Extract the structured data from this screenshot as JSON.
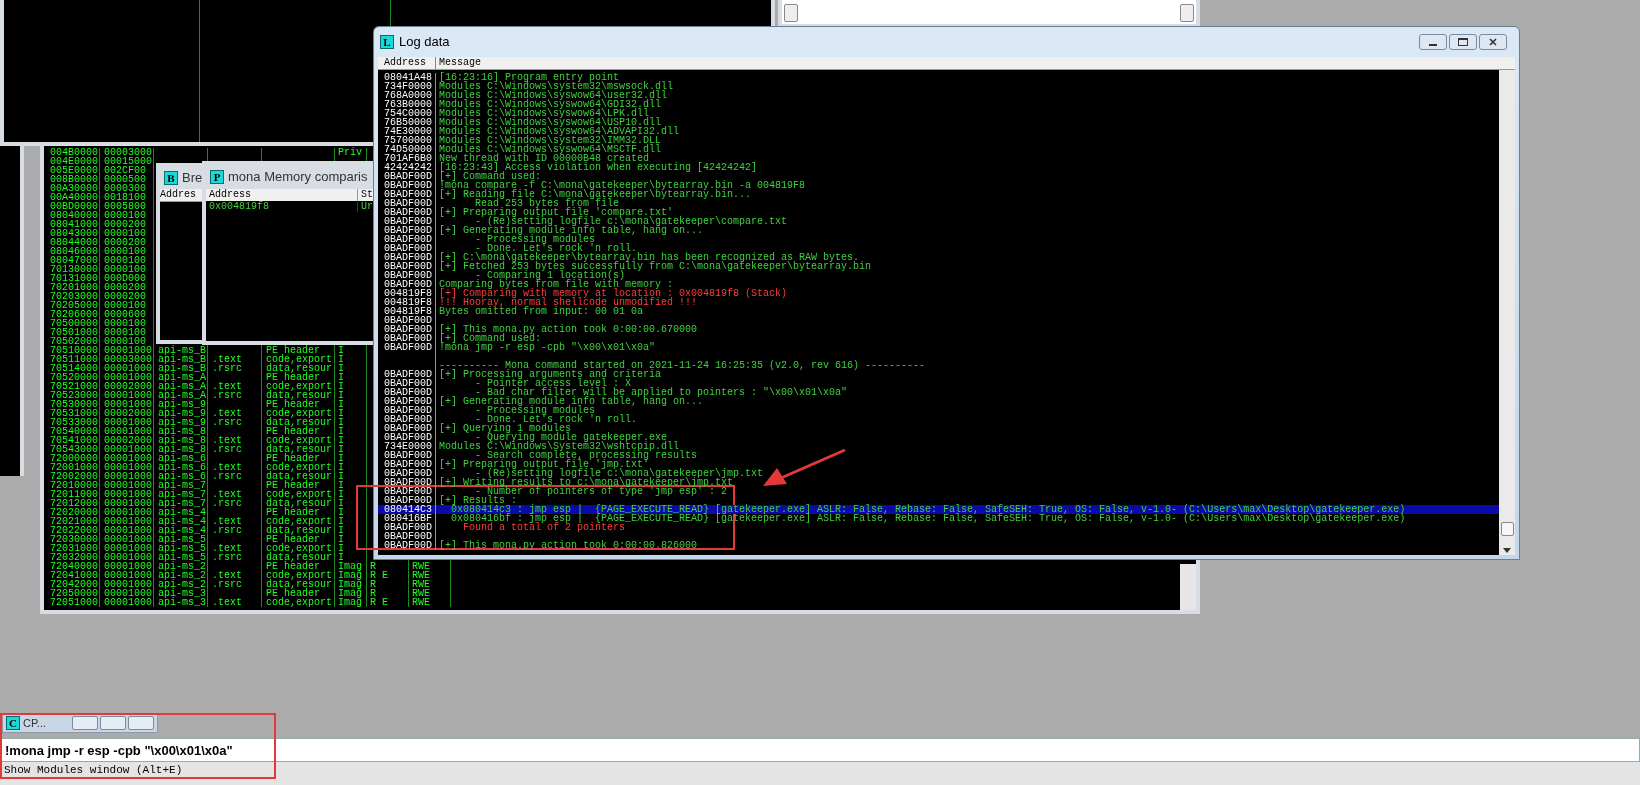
{
  "log_window": {
    "icon_letter": "L",
    "title": "Log data",
    "columns": [
      "Address",
      "Message"
    ],
    "rows": [
      {
        "address": "08041A48",
        "message": "[16:23:16] Program entry point",
        "kind": "info",
        "selected": false
      },
      {
        "address": "734F0000",
        "message": "Modules C:\\Windows\\system32\\mswsock.dll",
        "kind": "info",
        "selected": false
      },
      {
        "address": "768A0000",
        "message": "Modules C:\\Windows\\syswow64\\user32.dll",
        "kind": "info",
        "selected": false
      },
      {
        "address": "763B0000",
        "message": "Modules C:\\Windows\\syswow64\\GDI32.dll",
        "kind": "info",
        "selected": false
      },
      {
        "address": "754C0000",
        "message": "Modules C:\\Windows\\syswow64\\LPK.dll",
        "kind": "info",
        "selected": false
      },
      {
        "address": "76B50000",
        "message": "Modules C:\\Windows\\syswow64\\USP10.dll",
        "kind": "info",
        "selected": false
      },
      {
        "address": "74E30000",
        "message": "Modules C:\\Windows\\syswow64\\ADVAPI32.dll",
        "kind": "info",
        "selected": false
      },
      {
        "address": "75700000",
        "message": "Modules C:\\Windows\\system32\\IMM32.DLL",
        "kind": "info",
        "selected": false
      },
      {
        "address": "74D50000",
        "message": "Modules C:\\Windows\\syswow64\\MSCTF.dll",
        "kind": "info",
        "selected": false
      },
      {
        "address": "701AF6B0",
        "message": "New thread with ID 00000B48 created",
        "kind": "info",
        "selected": false
      },
      {
        "address": "42424242",
        "message": "[16:23:43] Access violation when executing [42424242]",
        "kind": "info",
        "selected": false
      },
      {
        "address": "0BADF00D",
        "message": "[+] Command used:",
        "kind": "info",
        "selected": false
      },
      {
        "address": "0BADF00D",
        "message": "!mona compare -f C:\\mona\\gatekeeper\\bytearray.bin -a 004819F8",
        "kind": "info",
        "selected": false
      },
      {
        "address": "0BADF00D",
        "message": "[+] Reading file C:\\mona\\gatekeeper\\bytearray.bin...",
        "kind": "info",
        "selected": false
      },
      {
        "address": "0BADF00D",
        "message": "      Read 253 bytes from file",
        "kind": "info",
        "selected": false
      },
      {
        "address": "0BADF00D",
        "message": "[+] Preparing output file 'compare.txt'",
        "kind": "info",
        "selected": false
      },
      {
        "address": "0BADF00D",
        "message": "      - (Re)setting logfile c:\\mona\\gatekeeper\\compare.txt",
        "kind": "info",
        "selected": false
      },
      {
        "address": "0BADF00D",
        "message": "[+] Generating module info table, hang on...",
        "kind": "info",
        "selected": false
      },
      {
        "address": "0BADF00D",
        "message": "      - Processing modules",
        "kind": "info",
        "selected": false
      },
      {
        "address": "0BADF00D",
        "message": "      - Done. Let's rock 'n roll.",
        "kind": "info",
        "selected": false
      },
      {
        "address": "0BADF00D",
        "message": "[+] C:\\mona\\gatekeeper\\bytearray.bin has been recognized as RAW bytes.",
        "kind": "info",
        "selected": false
      },
      {
        "address": "0BADF00D",
        "message": "[+] Fetched 253 bytes successfully from C:\\mona\\gatekeeper\\bytearray.bin",
        "kind": "info",
        "selected": false
      },
      {
        "address": "0BADF00D",
        "message": "      - Comparing 1 location(s)",
        "kind": "info",
        "selected": false
      },
      {
        "address": "0BADF00D",
        "message": "Comparing bytes from file with memory :",
        "kind": "info",
        "selected": false
      },
      {
        "address": "004819F8",
        "message": "[+] Comparing with memory at location : 0x004819f8 (Stack)",
        "kind": "alert",
        "selected": false
      },
      {
        "address": "004819F8",
        "message": "!!! Hooray, normal shellcode unmodified !!!",
        "kind": "alert",
        "selected": false
      },
      {
        "address": "004819F8",
        "message": "Bytes omitted from input: 00 01 0a",
        "kind": "info",
        "selected": false
      },
      {
        "address": "0BADF00D",
        "selected": false
      },
      {
        "address": "0BADF00D",
        "message": "[+] This mona.py action took 0:00:00.670000",
        "kind": "info",
        "selected": false
      },
      {
        "address": "0BADF00D",
        "message": "[+] Command used:",
        "kind": "info",
        "selected": false
      },
      {
        "address": "0BADF00D",
        "message": "!mona jmp -r esp -cpb \"\\x00\\x01\\x0a\"",
        "kind": "info",
        "selected": false
      },
      {
        "selected": false
      },
      {
        "message": "---------- Mona command started on 2021-11-24 16:25:35 (v2.0, rev 616) ----------",
        "kind": "info",
        "selected": false
      },
      {
        "address": "0BADF00D",
        "message": "[+] Processing arguments and criteria",
        "kind": "info",
        "selected": false
      },
      {
        "address": "0BADF00D",
        "message": "      - Pointer access level : X",
        "kind": "info",
        "selected": false
      },
      {
        "address": "0BADF00D",
        "message": "      - Bad char filter will be applied to pointers : \"\\x00\\x01\\x0a\"",
        "kind": "info",
        "selected": false
      },
      {
        "address": "0BADF00D",
        "message": "[+] Generating module info table, hang on...",
        "kind": "info",
        "selected": false
      },
      {
        "address": "0BADF00D",
        "message": "      - Processing modules",
        "kind": "info",
        "selected": false
      },
      {
        "address": "0BADF00D",
        "message": "      - Done. Let's rock 'n roll.",
        "kind": "info",
        "selected": false
      },
      {
        "address": "0BADF00D",
        "message": "[+] Querying 1 modules",
        "kind": "info",
        "selected": false
      },
      {
        "address": "0BADF00D",
        "message": "      - Querying module gatekeeper.exe",
        "kind": "info",
        "selected": false
      },
      {
        "address": "734E0000",
        "message": "Modules C:\\Windows\\System32\\wshtcpip.dll",
        "kind": "info",
        "selected": false
      },
      {
        "address": "0BADF00D",
        "message": "      - Search complete, processing results",
        "kind": "info",
        "selected": false
      },
      {
        "address": "0BADF00D",
        "message": "[+] Preparing output file 'jmp.txt'",
        "kind": "info",
        "selected": false
      },
      {
        "address": "0BADF00D",
        "message": "      - (Re)setting logfile c:\\mona\\gatekeeper\\jmp.txt",
        "kind": "info",
        "selected": false
      },
      {
        "address": "0BADF00D",
        "message": "[+] Writing results to c:\\mona\\gatekeeper\\jmp.txt",
        "kind": "info",
        "selected": false
      },
      {
        "address": "0BADF00D",
        "message": "      - Number of pointers of type 'jmp esp' : 2",
        "kind": "info",
        "selected": false
      },
      {
        "address": "0BADF00D",
        "message": "[+] Results :",
        "kind": "info",
        "selected": false
      },
      {
        "address": "080414C3",
        "message": "  0x080414c3 : jmp esp |  {PAGE_EXECUTE_READ} [gatekeeper.exe] ASLR: False, Rebase: False, SafeSEH: True, OS: False, v-1.0- (C:\\Users\\max\\Desktop\\gatekeeper.exe)",
        "kind": "info",
        "selected": true
      },
      {
        "address": "080416BF",
        "message": "  0x080416bf : jmp esp |  {PAGE_EXECUTE_READ} [gatekeeper.exe] ASLR: False, Rebase: False, SafeSEH: True, OS: False, v-1.0- (C:\\Users\\max\\Desktop\\gatekeeper.exe)",
        "kind": "info",
        "selected": false
      },
      {
        "address": "0BADF00D",
        "message": "    Found a total of 2 pointers",
        "kind": "alert",
        "selected": false
      },
      {
        "address": "0BADF00D",
        "selected": false
      },
      {
        "address": "0BADF00D",
        "message": "[+] This mona.py action took 0:00:00.826000",
        "kind": "info",
        "selected": false
      }
    ]
  },
  "memory_map": {
    "rows": [
      {
        "address": "004B0000",
        "size": "00003000",
        "type": "Priv"
      },
      {
        "address": "004E0000",
        "size": "00015000"
      },
      {
        "address": "005E0000",
        "size": "002CF00"
      },
      {
        "address": "008B0000",
        "size": "0000500"
      },
      {
        "address": "00A30000",
        "size": "0000300"
      },
      {
        "address": "00A40000",
        "size": "0018100"
      },
      {
        "address": "00BD0000",
        "size": "0005800"
      },
      {
        "address": "08040000",
        "size": "0000100"
      },
      {
        "address": "08041000",
        "size": "0000200"
      },
      {
        "address": "08043000",
        "size": "0000100"
      },
      {
        "address": "08044000",
        "size": "0000200"
      },
      {
        "address": "08046000",
        "size": "0000100"
      },
      {
        "address": "08047000",
        "size": "0000100"
      },
      {
        "address": "70130000",
        "size": "0000100"
      },
      {
        "address": "70131000",
        "size": "000D000"
      },
      {
        "address": "70201000",
        "size": "0000200"
      },
      {
        "address": "70203000",
        "size": "0000200"
      },
      {
        "address": "70205000",
        "size": "0000100"
      },
      {
        "address": "70206000",
        "size": "0000600"
      },
      {
        "address": "70500000",
        "size": "0000100"
      },
      {
        "address": "70501000",
        "size": "0000100"
      },
      {
        "address": "70502000",
        "size": "0000100"
      },
      {
        "address": "70510000",
        "size": "00001000",
        "owner": "api-ms_B",
        "contains": "PE header",
        "type": "I"
      },
      {
        "address": "70511000",
        "size": "00003000",
        "owner": "api-ms_B",
        "section": ".text",
        "contains": "code,export",
        "type": "I"
      },
      {
        "address": "70514000",
        "size": "00001000",
        "owner": "api-ms_B",
        "section": ".rsrc",
        "contains": "data,resour",
        "type": "I"
      },
      {
        "address": "70520000",
        "size": "00001000",
        "owner": "api-ms_A",
        "contains": "PE header",
        "type": "I"
      },
      {
        "address": "70521000",
        "size": "00002000",
        "owner": "api-ms_A",
        "section": ".text",
        "contains": "code,export",
        "type": "I"
      },
      {
        "address": "70523000",
        "size": "00001000",
        "owner": "api-ms_A",
        "section": ".rsrc",
        "contains": "data,resour",
        "type": "I"
      },
      {
        "address": "70530000",
        "size": "00001000",
        "owner": "api-ms_9",
        "contains": "PE header",
        "type": "I"
      },
      {
        "address": "70531000",
        "size": "00002000",
        "owner": "api-ms_9",
        "section": ".text",
        "contains": "code,export",
        "type": "I"
      },
      {
        "address": "70533000",
        "size": "00001000",
        "owner": "api-ms_9",
        "section": ".rsrc",
        "contains": "data,resour",
        "type": "I"
      },
      {
        "address": "70540000",
        "size": "00001000",
        "owner": "api-ms_8",
        "contains": "PE header",
        "type": "I"
      },
      {
        "address": "70541000",
        "size": "00002000",
        "owner": "api-ms_8",
        "section": ".text",
        "contains": "code,export",
        "type": "I"
      },
      {
        "address": "70543000",
        "size": "00001000",
        "owner": "api-ms_8",
        "section": ".rsrc",
        "contains": "data,resour",
        "type": "I"
      },
      {
        "address": "72000000",
        "size": "00001000",
        "owner": "api-ms_6",
        "contains": "PE header",
        "type": "I"
      },
      {
        "address": "72001000",
        "size": "00001000",
        "owner": "api-ms_6",
        "section": ".text",
        "contains": "code,export",
        "type": "I"
      },
      {
        "address": "72002000",
        "size": "00001000",
        "owner": "api-ms_6",
        "section": ".rsrc",
        "contains": "data,resour",
        "type": "I"
      },
      {
        "address": "72010000",
        "size": "00001000",
        "owner": "api-ms_7",
        "contains": "PE header",
        "type": "I"
      },
      {
        "address": "72011000",
        "size": "00001000",
        "owner": "api-ms_7",
        "section": ".text",
        "contains": "code,export",
        "type": "I"
      },
      {
        "address": "72012000",
        "size": "00001000",
        "owner": "api-ms_7",
        "section": ".rsrc",
        "contains": "data,resour",
        "type": "I"
      },
      {
        "address": "72020000",
        "size": "00001000",
        "owner": "api-ms_4",
        "contains": "PE header",
        "type": "I"
      },
      {
        "address": "72021000",
        "size": "00001000",
        "owner": "api-ms_4",
        "section": ".text",
        "contains": "code,export",
        "type": "I"
      },
      {
        "address": "72022000",
        "size": "00001000",
        "owner": "api-ms_4",
        "section": ".rsrc",
        "contains": "data,resour",
        "type": "I"
      },
      {
        "address": "72030000",
        "size": "00001000",
        "owner": "api-ms_5",
        "contains": "PE header",
        "type": "I"
      },
      {
        "address": "72031000",
        "size": "00001000",
        "owner": "api-ms_5",
        "section": ".text",
        "contains": "code,export",
        "type": "I"
      },
      {
        "address": "72032000",
        "size": "00001000",
        "owner": "api-ms_5",
        "section": ".rsrc",
        "contains": "data,resour",
        "type": "I"
      },
      {
        "address": "72040000",
        "size": "00001000",
        "owner": "api-ms_2",
        "contains": "PE header",
        "type": "Imag",
        "access": "R",
        "initial": "RWE"
      },
      {
        "address": "72041000",
        "size": "00001000",
        "owner": "api-ms_2",
        "section": ".text",
        "contains": "code,export",
        "type": "Imag",
        "access": "R E",
        "initial": "RWE"
      },
      {
        "address": "72042000",
        "size": "00001000",
        "owner": "api-ms_2",
        "section": ".rsrc",
        "contains": "data,resour",
        "type": "Imag",
        "access": "R",
        "initial": "RWE"
      },
      {
        "address": "72050000",
        "size": "00001000",
        "owner": "api-ms_3",
        "contains": "PE header",
        "type": "Imag",
        "access": "R",
        "initial": "RWE"
      },
      {
        "address": "72051000",
        "size": "00001000",
        "owner": "api-ms_3",
        "section": ".text",
        "contains": "code,export",
        "type": "Imag",
        "access": "R E",
        "initial": "RWE"
      }
    ]
  },
  "breakpoints_window": {
    "icon_letter": "B",
    "title": "Bre",
    "columns": [
      "Addres"
    ]
  },
  "compare_window": {
    "icon_letter": "P",
    "title": "mona Memory comparis",
    "columns": [
      "Address",
      "St"
    ],
    "rows": [
      {
        "address": "0x004819f8",
        "status": "Ur"
      }
    ]
  },
  "cpu_window": {
    "icon_letter": "C",
    "title": "CP..."
  },
  "command_line": {
    "value": "!mona jmp -r esp -cpb \"\\x00\\x01\\x0a\""
  },
  "status_bar": {
    "text": "Show Modules window (Alt+E)"
  }
}
